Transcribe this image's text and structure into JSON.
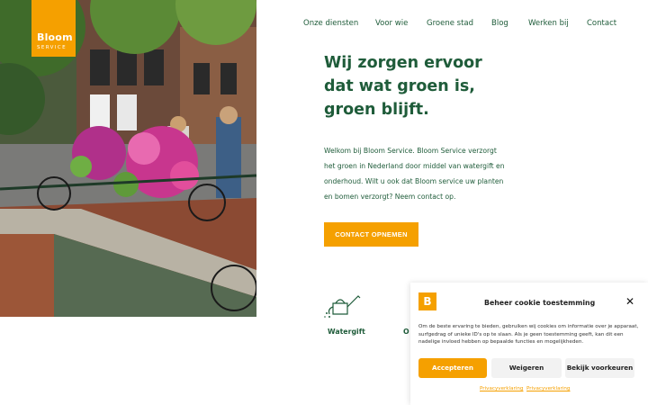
{
  "brand": {
    "name": "Bloom",
    "sub": "SERVICE",
    "accent": "#f5a000",
    "primary_text": "#1f5c3a"
  },
  "nav": {
    "items": [
      "Onze diensten",
      "Voor wie",
      "Groene stad",
      "Blog",
      "Werken bij",
      "Contact"
    ]
  },
  "hero": {
    "headline": [
      "Wij zorgen ervoor",
      "dat wat groen is,",
      "groen blijft."
    ],
    "intro": "Welkom bij Bloom Service. Bloom Service verzorgt het groen in Nederland door middel van watergift en onderhoud. Wilt u ook dat Bloom service uw planten en bomen verzorgt? Neem contact op.",
    "cta": "CONTACT OPNEMEN"
  },
  "services": [
    {
      "label": "Watergift",
      "icon": "watering-can-icon"
    },
    {
      "label": "O",
      "icon": ""
    }
  ],
  "cookie": {
    "badge": "B",
    "title": "Beheer cookie toestemming",
    "close": "✕",
    "message": "Om de beste ervaring te bieden, gebruiken wij cookies om informatie over je apparaat, surfgedrag of unieke ID's op te slaan. Als je geen toestemming geeft, kan dit een nadelige invloed hebben op bepaalde functies en mogelijkheden.",
    "accept": "Accepteren",
    "deny": "Weigeren",
    "preferences": "Bekijk voorkeuren",
    "links": [
      "Privacyverklaring",
      "Privacyverklaring"
    ]
  }
}
